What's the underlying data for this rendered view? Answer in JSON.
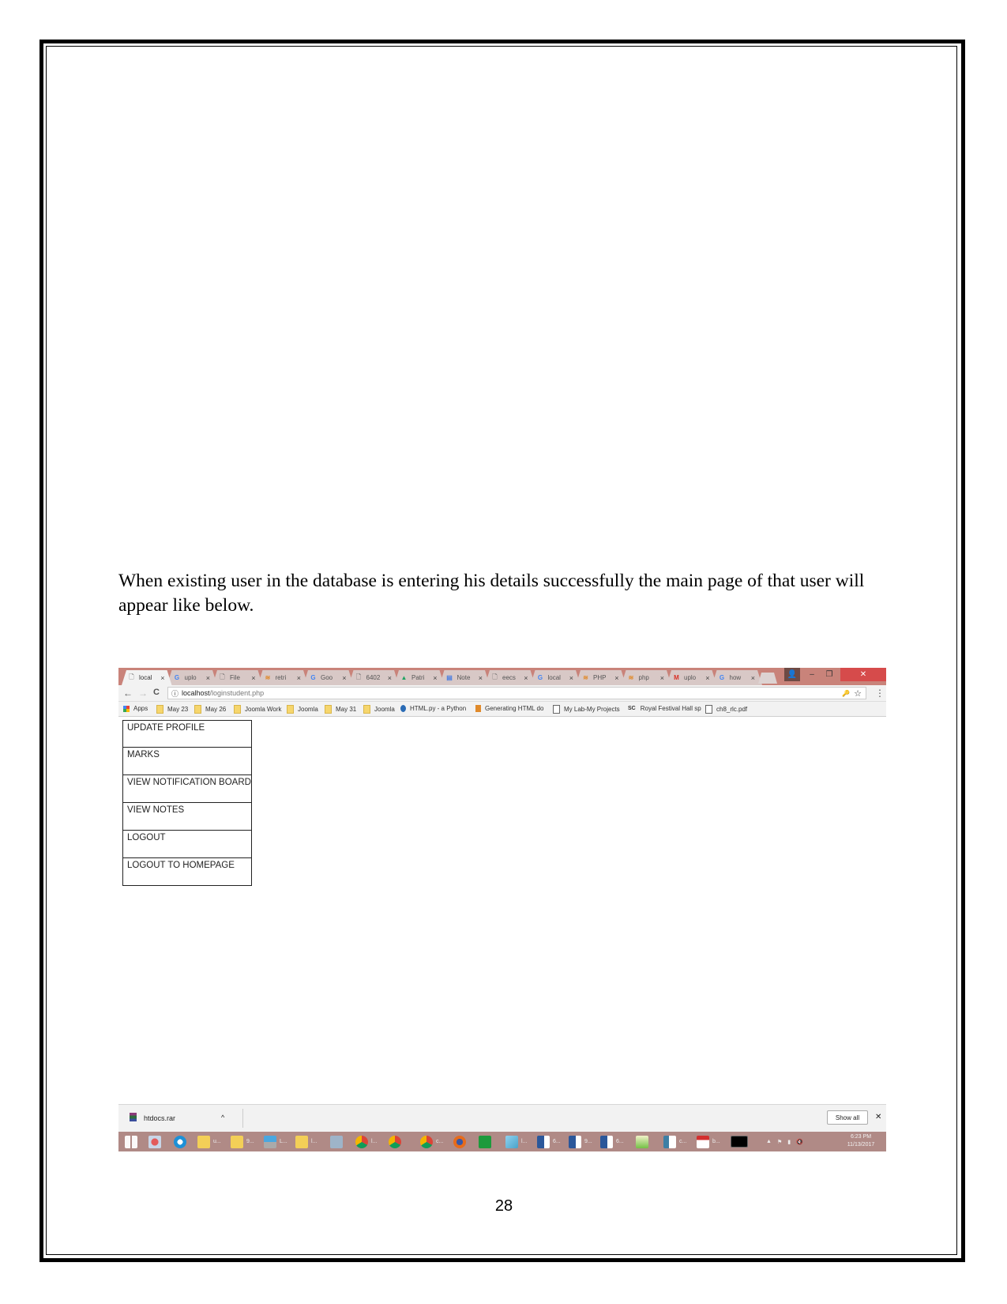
{
  "document": {
    "paragraph": "When existing user in the database is entering his details successfully the main page of that user will appear like below.",
    "page_number": "28"
  },
  "browser": {
    "tabs": [
      {
        "label": "local",
        "icon": "page-icon",
        "active": true
      },
      {
        "label": "uplo",
        "icon": "google-icon"
      },
      {
        "label": "File",
        "icon": "page-icon"
      },
      {
        "label": "retri",
        "icon": "stackoverflow-icon"
      },
      {
        "label": "Goo",
        "icon": "google-icon"
      },
      {
        "label": "6402",
        "icon": "page-icon"
      },
      {
        "label": "Patri",
        "icon": "drive-icon"
      },
      {
        "label": "Note",
        "icon": "docs-icon"
      },
      {
        "label": "eecs",
        "icon": "page-icon"
      },
      {
        "label": "local",
        "icon": "google-icon"
      },
      {
        "label": "PHP",
        "icon": "stackoverflow-icon"
      },
      {
        "label": "php",
        "icon": "stackoverflow-icon"
      },
      {
        "label": "uplo",
        "icon": "gmail-icon"
      },
      {
        "label": "how",
        "icon": "google-icon"
      }
    ],
    "tab_close_glyph": "×",
    "window_controls": {
      "minimize": "–",
      "maximize": "❐",
      "close": "✕"
    },
    "nav": {
      "back": "←",
      "forward": "→",
      "reload": "C"
    },
    "url": {
      "host": "localhost",
      "path": "/loginstudent.php",
      "info_glyph": "ⓘ"
    },
    "omnibox_icons": {
      "key": "🔑",
      "star": "☆",
      "menu": "⋮"
    },
    "bookmarks": [
      {
        "label": "Apps",
        "icon": "apps-icon"
      },
      {
        "label": "May 23",
        "icon": "folder-icon"
      },
      {
        "label": "May 26",
        "icon": "folder-icon"
      },
      {
        "label": "Joomla Work",
        "icon": "folder-icon"
      },
      {
        "label": "Joomla",
        "icon": "folder-icon"
      },
      {
        "label": "May 31",
        "icon": "folder-icon"
      },
      {
        "label": "Joomla",
        "icon": "folder-icon"
      },
      {
        "label": "HTML.py - a Python",
        "icon": "drupal-icon"
      },
      {
        "label": "Generating HTML do",
        "icon": "stackoverflow-icon"
      },
      {
        "label": "My Lab-My Projects",
        "icon": "page-icon"
      },
      {
        "label": "Royal Festival Hall sp",
        "icon": "sc-icon"
      },
      {
        "label": "ch8_rlc.pdf",
        "icon": "page-icon"
      }
    ],
    "menu": [
      "UPDATE PROFILE",
      "MARKS",
      "VIEW NOTIFICATION BOARD",
      "VIEW NOTES",
      "LOGOUT",
      "LOGOUT TO HOMEPAGE"
    ],
    "download_bar": {
      "file": "htdocs.rar",
      "chevron": "^",
      "show_all": "Show all",
      "close": "✕"
    }
  },
  "taskbar": {
    "items": [
      {
        "icon": "windows-start-icon",
        "label": ""
      },
      {
        "icon": "snipping-tool-icon",
        "label": ""
      },
      {
        "icon": "internet-explorer-icon",
        "label": ""
      },
      {
        "icon": "folder-icon",
        "label": "u..."
      },
      {
        "icon": "folder-icon",
        "label": "9..."
      },
      {
        "icon": "network-icon",
        "label": "L..."
      },
      {
        "icon": "folder-icon",
        "label": "l..."
      },
      {
        "icon": "calculator-icon",
        "label": ""
      },
      {
        "icon": "chrome-icon",
        "label": "l..."
      },
      {
        "icon": "chrome-icon",
        "label": ""
      },
      {
        "icon": "chrome-icon",
        "label": "c..."
      },
      {
        "icon": "firefox-icon",
        "label": ""
      },
      {
        "icon": "store-icon",
        "label": ""
      },
      {
        "icon": "notepad-icon",
        "label": "l..."
      },
      {
        "icon": "word-icon",
        "label": "6..."
      },
      {
        "icon": "word-icon",
        "label": "9..."
      },
      {
        "icon": "word-icon",
        "label": "6..."
      },
      {
        "icon": "paint-icon",
        "label": ""
      },
      {
        "icon": "screen-icon",
        "label": "c..."
      },
      {
        "icon": "pdf-icon",
        "label": "b..."
      },
      {
        "icon": "cmd-icon",
        "label": ""
      }
    ],
    "tray": {
      "up": "▲",
      "flag": "⚑",
      "signal": "▮",
      "volume": "🔇"
    },
    "time": "6:23 PM",
    "date": "11/13/2017"
  }
}
